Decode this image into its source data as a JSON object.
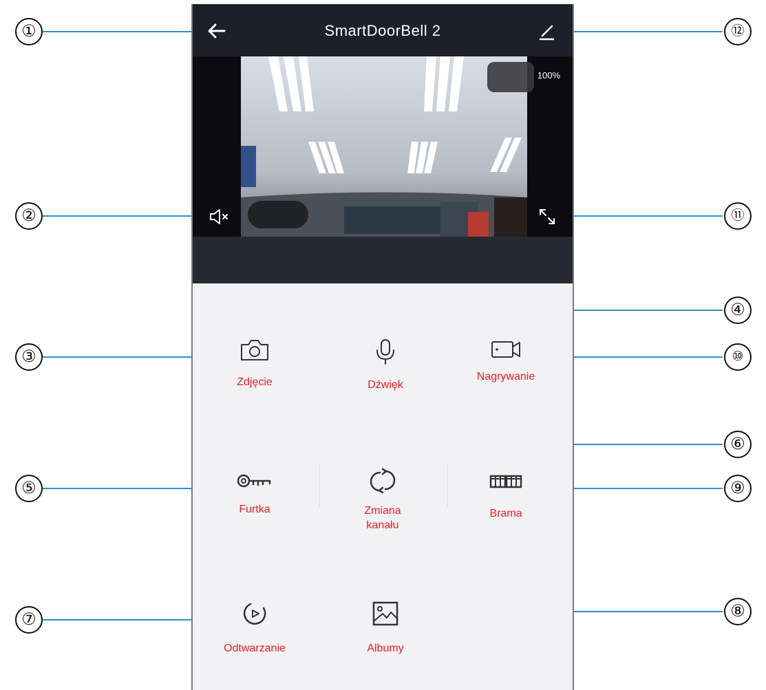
{
  "header": {
    "title": "SmartDoorBell 2"
  },
  "video": {
    "zoom_label": "100%"
  },
  "controls": {
    "photo": "Zdjęcie",
    "sound": "Dźwięk",
    "record": "Nagrywanie",
    "gate": "Furtka",
    "channel": "Zmiana\nkanału",
    "gate_main": "Brama",
    "playback": "Odtwarzanie",
    "albums": "Albumy"
  },
  "callouts": [
    "①",
    "②",
    "③",
    "④",
    "⑤",
    "⑥",
    "⑦",
    "⑧",
    "⑨",
    "⑩",
    "⑪",
    "⑫"
  ],
  "icons": {
    "back": "arrow-left-icon",
    "edit": "pencil-icon",
    "mute": "speaker-muted-icon",
    "fullscreen": "expand-icon",
    "photo": "camera-icon",
    "sound": "microphone-icon",
    "record": "video-camera-icon",
    "gate": "key-icon",
    "channel": "switch-channel-icon",
    "gate_main": "gate-icon",
    "playback": "playback-icon",
    "albums": "image-icon"
  },
  "colors": {
    "accent": "#ee1c24",
    "callout_line": "#2a8fd0",
    "header_bg": "#1d1f2a"
  }
}
